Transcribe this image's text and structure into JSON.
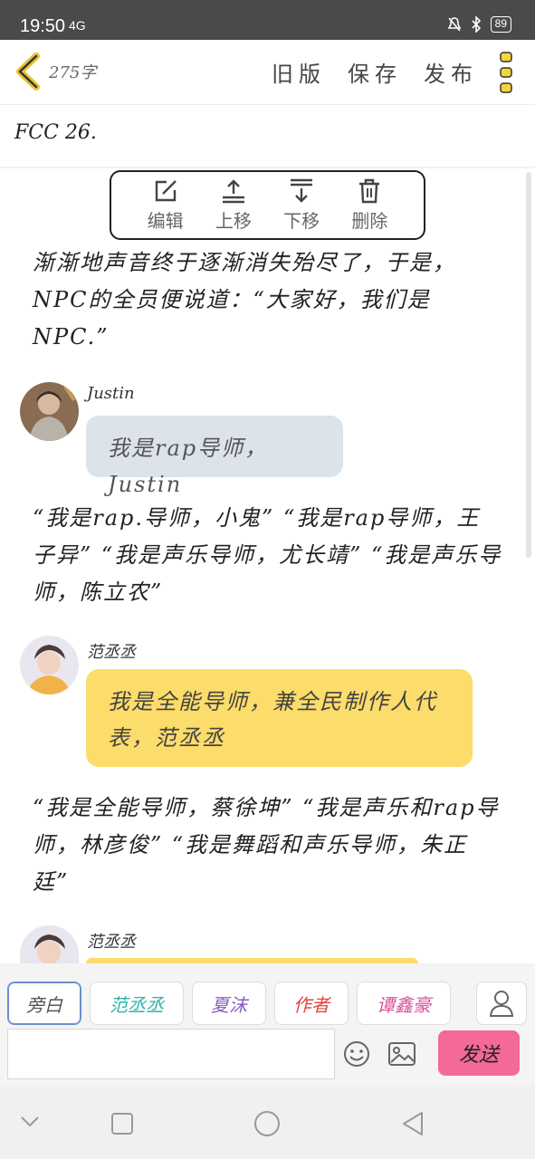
{
  "status_bar": {
    "time": "19:50",
    "signal": "4G",
    "battery": "89"
  },
  "header": {
    "word_count": "275字",
    "menu": [
      "旧版",
      "保存",
      "发布"
    ]
  },
  "doc_title": "FCC 26.",
  "context_toolbar": [
    {
      "label": "编辑",
      "icon": "edit-icon"
    },
    {
      "label": "上移",
      "icon": "move-up-icon"
    },
    {
      "label": "下移",
      "icon": "move-down-icon"
    },
    {
      "label": "删除",
      "icon": "delete-icon"
    }
  ],
  "content": {
    "narration_1": "渐渐地声音终于逐渐消失殆尽了，于是，NPC的全员便说道：“大家好，我们是NPC.”",
    "msg_1": {
      "speaker": "Justin",
      "text": "我是rap导师，Justin"
    },
    "narration_2": "“我是rap.导师，小鬼” “我是rap导师，王子异” “我是声乐导师，尤长靖” “我是声乐导师，陈立农”",
    "msg_2": {
      "speaker": "范丞丞",
      "text": "我是全能导师，兼全民制作人代表，范丞丞"
    },
    "narration_3": "“我是全能导师，蔡徐坤” “我是声乐和rap导师，林彦俊” “我是舞蹈和声乐导师，朱正廷”",
    "msg_3": {
      "speaker": "范丞丞"
    }
  },
  "composer": {
    "roles": [
      {
        "label": "旁白",
        "color": "#555555"
      },
      {
        "label": "范丞丞",
        "color": "#2bb3a8"
      },
      {
        "label": "夏沫",
        "color": "#8a5cc7"
      },
      {
        "label": "作者",
        "color": "#e0463c"
      },
      {
        "label": "谭鑫豪",
        "color": "#d94d9a"
      }
    ],
    "send_label": "发送"
  },
  "colors": {
    "accent_yellow": "#fcdc6a",
    "send_pink": "#f2699a",
    "bubble_gray": "#dde3ea"
  }
}
